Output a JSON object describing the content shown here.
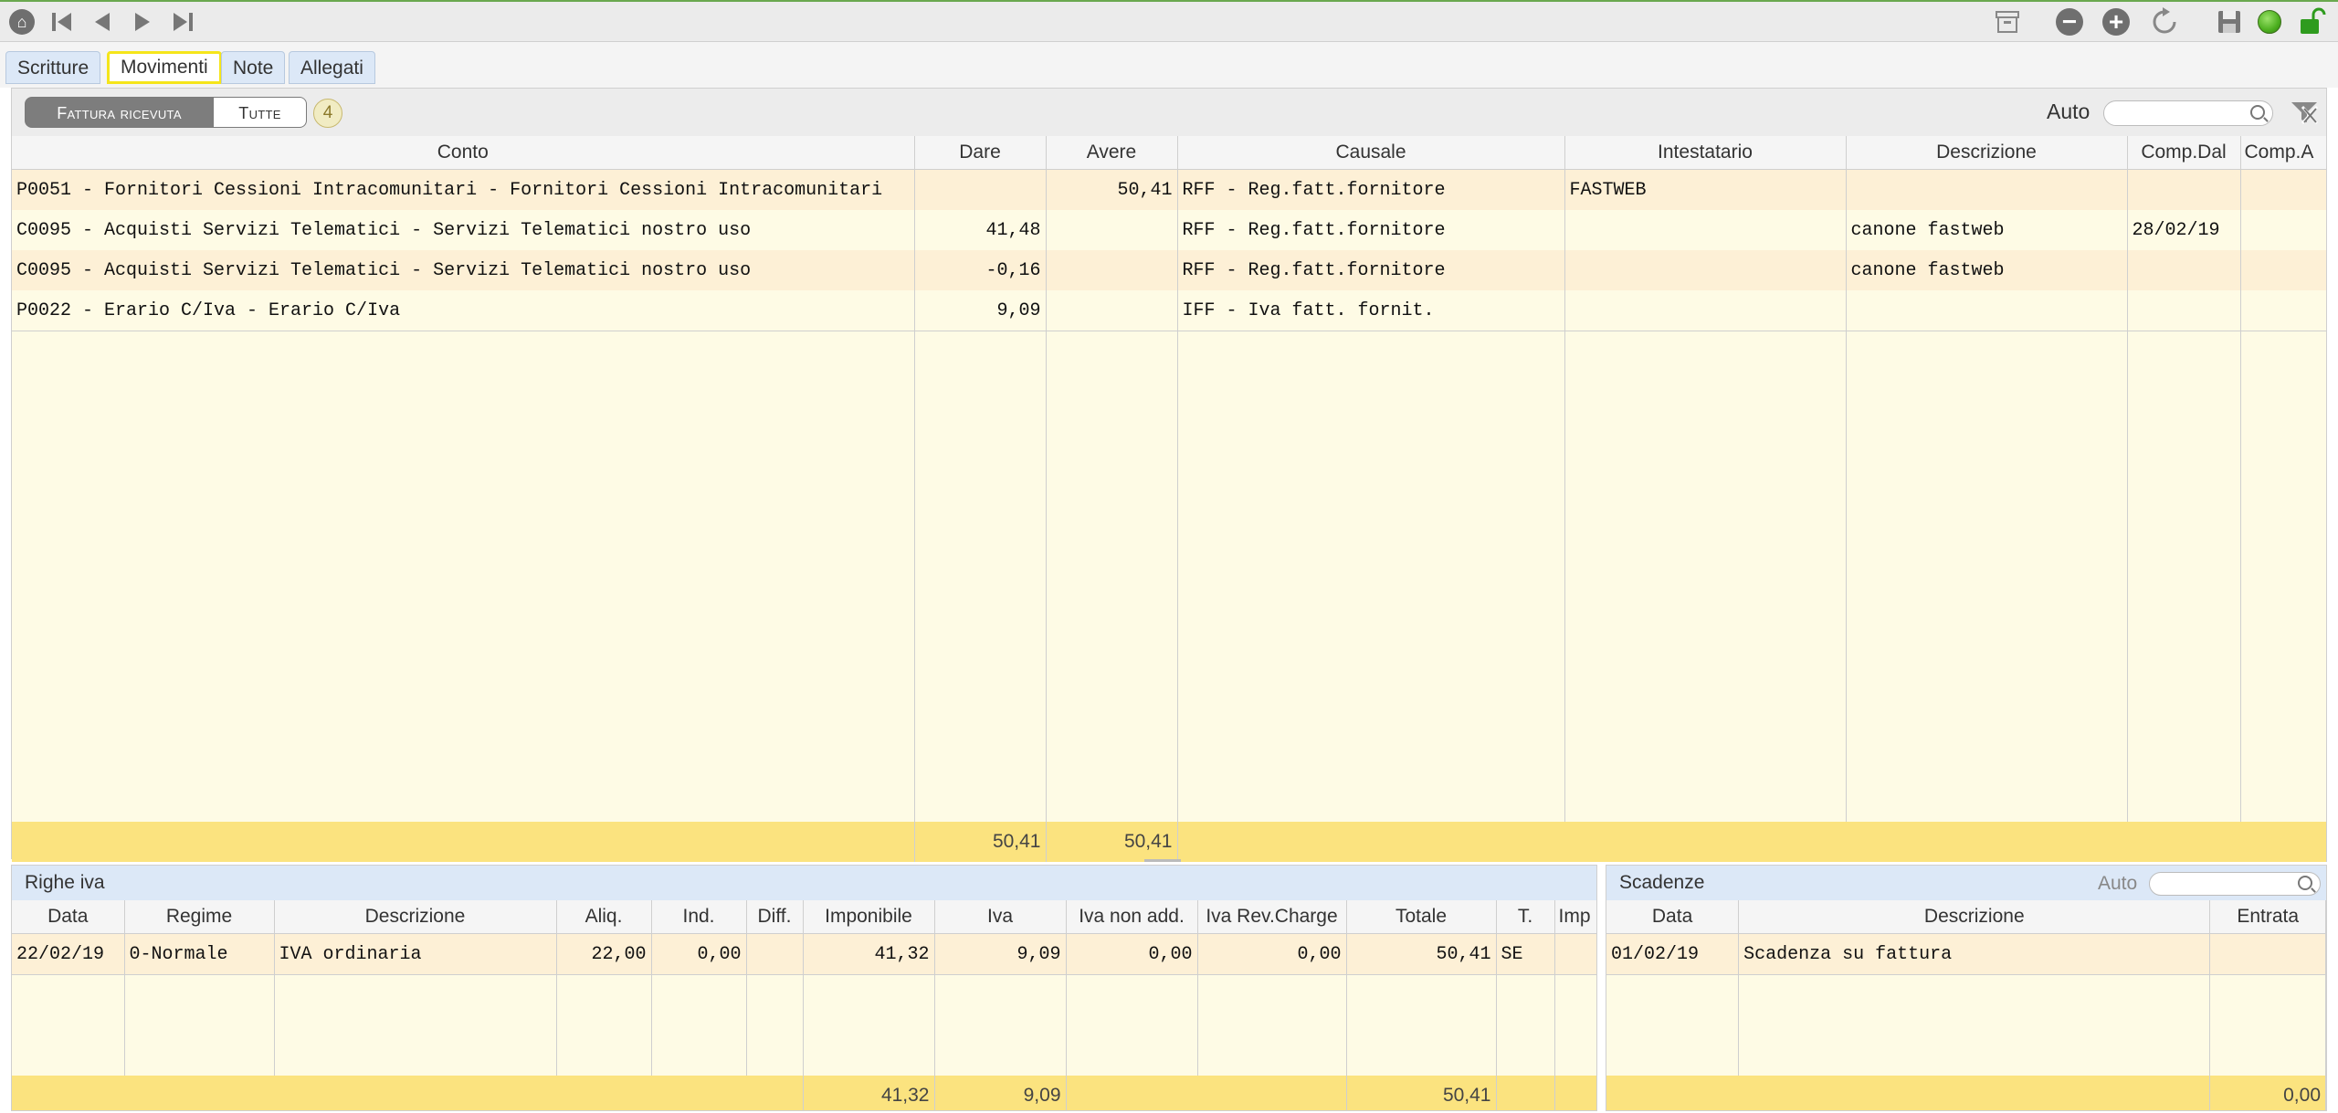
{
  "toolbar": {
    "left_icons": [
      "home-icon",
      "first-record-icon",
      "previous-record-icon",
      "next-record-icon",
      "last-record-icon"
    ],
    "right_icons": [
      "archive-icon",
      "remove-icon",
      "add-icon",
      "refresh-icon",
      "save-icon",
      "status-led-icon",
      "unlock-icon"
    ],
    "status_color": "#4caf1f"
  },
  "tabs": [
    {
      "label": "Scritture"
    },
    {
      "label": "Movimenti",
      "active": true
    },
    {
      "label": "Note"
    },
    {
      "label": "Allegati"
    }
  ],
  "movimenti": {
    "filter_selected": "Fattura ricevuta",
    "filter_all": "Tutte",
    "count": "4",
    "auto_label": "Auto",
    "search_value": "",
    "columns": [
      "Conto",
      "Dare",
      "Avere",
      "Causale",
      "Intestatario",
      "Descrizione",
      "Comp.Dal",
      "Comp.A"
    ],
    "rows": [
      {
        "conto": "P0051 - Fornitori Cessioni Intracomunitari - Fornitori Cessioni Intracomunitari",
        "dare": "",
        "avere": "50,41",
        "causale": "RFF - Reg.fatt.fornitore",
        "intestatario": "FASTWEB",
        "descrizione": "",
        "comp_dal": "",
        "comp_al": ""
      },
      {
        "conto": "C0095 - Acquisti Servizi Telematici - Servizi Telematici nostro uso",
        "dare": "41,48",
        "avere": "",
        "causale": "RFF - Reg.fatt.fornitore",
        "intestatario": "",
        "descrizione": "canone fastweb",
        "comp_dal": "28/02/19",
        "comp_al": ""
      },
      {
        "conto": "C0095 - Acquisti Servizi Telematici - Servizi Telematici nostro uso",
        "dare": "-0,16",
        "avere": "",
        "causale": "RFF - Reg.fatt.fornitore",
        "intestatario": "",
        "descrizione": "canone fastweb",
        "comp_dal": "",
        "comp_al": ""
      },
      {
        "conto": "P0022 - Erario C/Iva - Erario C/Iva",
        "dare": "9,09",
        "avere": "",
        "causale": "IFF - Iva fatt. fornit.",
        "intestatario": "",
        "descrizione": "",
        "comp_dal": "",
        "comp_al": ""
      }
    ],
    "totals": {
      "dare": "50,41",
      "avere": "50,41"
    }
  },
  "righe_iva": {
    "title": "Righe iva",
    "columns": [
      "Data",
      "Regime",
      "Descrizione",
      "Aliq.",
      "Ind.",
      "Diff.",
      "Imponibile",
      "Iva",
      "Iva non add.",
      "Iva Rev.Charge",
      "Totale",
      "T.",
      "Imp"
    ],
    "rows": [
      {
        "data": "22/02/19",
        "regime": "0-Normale",
        "descrizione": "IVA ordinaria",
        "aliq": "22,00",
        "ind": "0,00",
        "diff": "",
        "imponibile": "41,32",
        "iva": "9,09",
        "iva_non_add": "0,00",
        "iva_rev": "0,00",
        "totale": "50,41",
        "t": "SE",
        "imp": ""
      }
    ],
    "totals": {
      "imponibile": "41,32",
      "iva": "9,09",
      "totale": "50,41"
    }
  },
  "scadenze": {
    "title": "Scadenze",
    "auto_label": "Auto",
    "search_value": "",
    "columns": [
      "Data",
      "Descrizione",
      "Entrata"
    ],
    "rows": [
      {
        "data": "01/02/19",
        "descrizione": "Scadenza su fattura",
        "entrata": ""
      }
    ],
    "totals": {
      "entrata": "0,00"
    }
  }
}
